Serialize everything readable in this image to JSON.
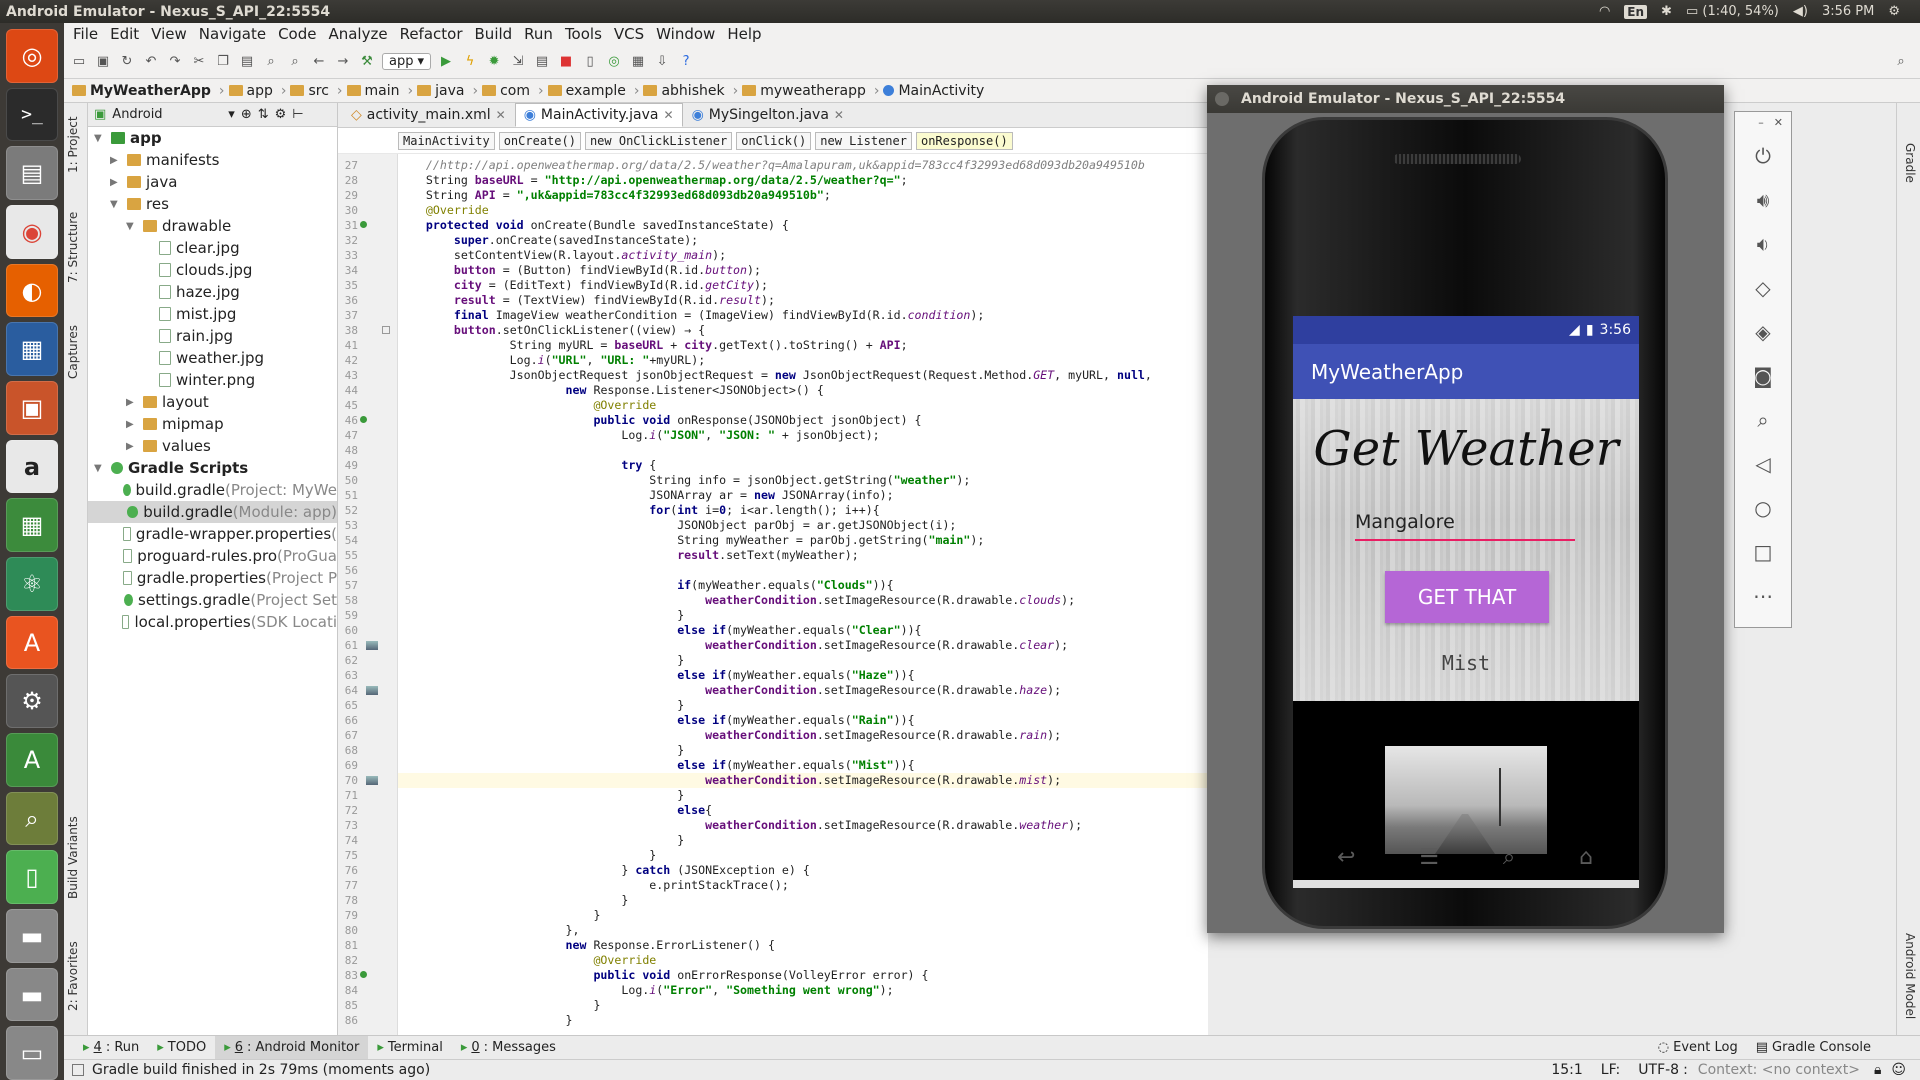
{
  "window_title": "Android Emulator - Nexus_S_API_22:5554",
  "tray": {
    "keyboard": "En",
    "battery": "(1:40, 54%)",
    "clock": "3:56 PM"
  },
  "menu": [
    "File",
    "Edit",
    "View",
    "Navigate",
    "Code",
    "Analyze",
    "Refactor",
    "Build",
    "Run",
    "Tools",
    "VCS",
    "Window",
    "Help"
  ],
  "run_config": "app",
  "breadcrumb": [
    "MyWeatherApp",
    "app",
    "src",
    "main",
    "java",
    "com",
    "example",
    "abhishek",
    "myweatherapp",
    "MainActivity"
  ],
  "project_view": "Android",
  "tree": [
    {
      "label": "app",
      "extra": "",
      "depth": 0,
      "kind": "module",
      "open": true
    },
    {
      "label": "manifests",
      "extra": "",
      "depth": 1,
      "kind": "folder",
      "open": false
    },
    {
      "label": "java",
      "extra": "",
      "depth": 1,
      "kind": "folder",
      "open": false
    },
    {
      "label": "res",
      "extra": "",
      "depth": 1,
      "kind": "folder",
      "open": true
    },
    {
      "label": "drawable",
      "extra": "",
      "depth": 2,
      "kind": "folder",
      "open": true
    },
    {
      "label": "clear.jpg",
      "extra": "",
      "depth": 3,
      "kind": "file"
    },
    {
      "label": "clouds.jpg",
      "extra": "",
      "depth": 3,
      "kind": "file"
    },
    {
      "label": "haze.jpg",
      "extra": "",
      "depth": 3,
      "kind": "file"
    },
    {
      "label": "mist.jpg",
      "extra": "",
      "depth": 3,
      "kind": "file"
    },
    {
      "label": "rain.jpg",
      "extra": "",
      "depth": 3,
      "kind": "file"
    },
    {
      "label": "weather.jpg",
      "extra": "",
      "depth": 3,
      "kind": "file"
    },
    {
      "label": "winter.png",
      "extra": "",
      "depth": 3,
      "kind": "file"
    },
    {
      "label": "layout",
      "extra": "",
      "depth": 2,
      "kind": "folder",
      "open": false
    },
    {
      "label": "mipmap",
      "extra": "",
      "depth": 2,
      "kind": "folder",
      "open": false
    },
    {
      "label": "values",
      "extra": "",
      "depth": 2,
      "kind": "folder",
      "open": false
    },
    {
      "label": "Gradle Scripts",
      "extra": "",
      "depth": 0,
      "kind": "gradle",
      "open": true
    },
    {
      "label": "build.gradle",
      "extra": " (Project: MyWe",
      "depth": 1,
      "kind": "gradle"
    },
    {
      "label": "build.gradle",
      "extra": " (Module: app)",
      "depth": 1,
      "kind": "gradle",
      "selected": true
    },
    {
      "label": "gradle-wrapper.properties",
      "extra": " (",
      "depth": 1,
      "kind": "file"
    },
    {
      "label": "proguard-rules.pro",
      "extra": " (ProGua",
      "depth": 1,
      "kind": "file"
    },
    {
      "label": "gradle.properties",
      "extra": " (Project P",
      "depth": 1,
      "kind": "file"
    },
    {
      "label": "settings.gradle",
      "extra": " (Project Set",
      "depth": 1,
      "kind": "gradle"
    },
    {
      "label": "local.properties",
      "extra": " (SDK Locati",
      "depth": 1,
      "kind": "file"
    }
  ],
  "editor_tabs": [
    {
      "label": "activity_main.xml",
      "active": false
    },
    {
      "label": "MainActivity.java",
      "active": true
    },
    {
      "label": "MySingelton.java",
      "active": false
    }
  ],
  "structure_bar": [
    "MainActivity",
    "onCreate()",
    "new OnClickListener",
    "onClick()",
    "new Listener",
    "onResponse()"
  ],
  "code_lines": [
    {
      "n": 27,
      "t": "    <span class=\"cm\">//http://api.openweathermap.org/data/2.5/weather?q=Amalapuram,uk&appid=783cc4f32993ed68d093db20a949510b</span>"
    },
    {
      "n": 28,
      "t": "    String <span class=\"fld\">baseURL</span> = <span class=\"st\">\"http://api.openweathermap.org/data/2.5/weather?q=\"</span>;"
    },
    {
      "n": 29,
      "t": "    String <span class=\"fld\">API</span> = <span class=\"st\">\",uk&appid=783cc4f32993ed68d093db20a949510b\"</span>;"
    },
    {
      "n": 30,
      "t": "    <span class=\"an\">@Override</span>"
    },
    {
      "n": 31,
      "t": "    <span class=\"kw\">protected void</span> onCreate(Bundle savedInstanceState) {"
    },
    {
      "n": 32,
      "t": "        <span class=\"kw\">super</span>.onCreate(savedInstanceState);"
    },
    {
      "n": 33,
      "t": "        setContentView(R.layout.<span class=\"sfi\">activity_main</span>);"
    },
    {
      "n": 34,
      "t": "        <span class=\"fld\">button</span> = (Button) findViewById(R.id.<span class=\"sfi\">button</span>);"
    },
    {
      "n": 35,
      "t": "        <span class=\"fld\">city</span> = (EditText) findViewById(R.id.<span class=\"sfi\">getCity</span>);"
    },
    {
      "n": 36,
      "t": "        <span class=\"fld\">result</span> = (TextView) findViewById(R.id.<span class=\"sfi\">result</span>);"
    },
    {
      "n": 37,
      "t": "        <span class=\"kw\">final</span> ImageView weatherCondition = (ImageView) findViewById(R.id.<span class=\"sfi\">condition</span>);"
    },
    {
      "n": 38,
      "t": "        <span class=\"fld\">button</span>.setOnClickListener((view) → {"
    },
    {
      "n": 41,
      "t": "                String myURL = <span class=\"fld\">baseURL</span> + <span class=\"fld\">city</span>.getText().toString() + <span class=\"fld\">API</span>;"
    },
    {
      "n": 42,
      "t": "                Log.<span class=\"sfi\">i</span>(<span class=\"st\">\"URL\"</span>, <span class=\"st\">\"URL: \"</span>+myURL);"
    },
    {
      "n": 43,
      "t": "                JsonObjectRequest jsonObjectRequest = <span class=\"kw\">new</span> JsonObjectRequest(Request.Method.<span class=\"sfi\">GET</span>, myURL, <span class=\"kw\">null</span>,"
    },
    {
      "n": 44,
      "t": "                        <span class=\"kw\">new</span> Response.Listener&lt;JSONObject&gt;() {"
    },
    {
      "n": 45,
      "t": "                            <span class=\"an\">@Override</span>"
    },
    {
      "n": 46,
      "t": "                            <span class=\"kw\">public void</span> onResponse(JSONObject jsonObject) {"
    },
    {
      "n": 47,
      "t": "                                Log.<span class=\"sfi\">i</span>(<span class=\"st\">\"JSON\"</span>, <span class=\"st\">\"JSON: \"</span> + jsonObject);"
    },
    {
      "n": 48,
      "t": ""
    },
    {
      "n": 49,
      "t": "                                <span class=\"kw\">try</span> {"
    },
    {
      "n": 50,
      "t": "                                    String info = jsonObject.getString(<span class=\"st\">\"weather\"</span>);"
    },
    {
      "n": 51,
      "t": "                                    JSONArray ar = <span class=\"kw\">new</span> JSONArray(info);"
    },
    {
      "n": 52,
      "t": "                                    <span class=\"kw\">for</span>(<span class=\"kw\">int</span> i=<span class=\"kw\">0</span>; i&lt;ar.length(); i++){"
    },
    {
      "n": 53,
      "t": "                                        JSONObject parObj = ar.getJSONObject(i);"
    },
    {
      "n": 54,
      "t": "                                        String myWeather = parObj.getString(<span class=\"st\">\"main\"</span>);"
    },
    {
      "n": 55,
      "t": "                                        <span class=\"fld\">result</span>.setText(myWeather);"
    },
    {
      "n": 56,
      "t": ""
    },
    {
      "n": 57,
      "t": "                                        <span class=\"kw\">if</span>(myWeather.equals(<span class=\"st\">\"Clouds\"</span>)){"
    },
    {
      "n": 58,
      "t": "                                            <span class=\"fld\">weatherCondition</span>.setImageResource(R.drawable.<span class=\"sfi\">clouds</span>);"
    },
    {
      "n": 59,
      "t": "                                        }"
    },
    {
      "n": 60,
      "t": "                                        <span class=\"kw\">else if</span>(myWeather.equals(<span class=\"st\">\"Clear\"</span>)){"
    },
    {
      "n": 61,
      "t": "                                            <span class=\"fld\">weatherCondition</span>.setImageResource(R.drawable.<span class=\"sfi\">clear</span>);"
    },
    {
      "n": 62,
      "t": "                                        }"
    },
    {
      "n": 63,
      "t": "                                        <span class=\"kw\">else if</span>(myWeather.equals(<span class=\"st\">\"Haze\"</span>)){"
    },
    {
      "n": 64,
      "t": "                                            <span class=\"fld\">weatherCondition</span>.setImageResource(R.drawable.<span class=\"sfi\">haze</span>);"
    },
    {
      "n": 65,
      "t": "                                        }"
    },
    {
      "n": 66,
      "t": "                                        <span class=\"kw\">else if</span>(myWeather.equals(<span class=\"st\">\"Rain\"</span>)){"
    },
    {
      "n": 67,
      "t": "                                            <span class=\"fld\">weatherCondition</span>.setImageResource(R.drawable.<span class=\"sfi\">rain</span>);"
    },
    {
      "n": 68,
      "t": "                                        }"
    },
    {
      "n": 69,
      "t": "                                        <span class=\"kw\">else if</span>(myWeather.equals(<span class=\"st\">\"Mist\"</span>)){"
    },
    {
      "n": 70,
      "t": "                                            <span class=\"fld\">weatherCondition</span>.setImageResource(R.drawable.<span class=\"sfi\">mist</span>);",
      "current": true
    },
    {
      "n": 71,
      "t": "                                        }"
    },
    {
      "n": 72,
      "t": "                                        <span class=\"kw\">else</span>{"
    },
    {
      "n": 73,
      "t": "                                            <span class=\"fld\">weatherCondition</span>.setImageResource(R.drawable.<span class=\"sfi\">weather</span>);"
    },
    {
      "n": 74,
      "t": "                                        }"
    },
    {
      "n": 75,
      "t": "                                    }"
    },
    {
      "n": 76,
      "t": "                                } <span class=\"kw\">catch</span> (JSONException e) {"
    },
    {
      "n": 77,
      "t": "                                    e.printStackTrace();"
    },
    {
      "n": 78,
      "t": "                                }"
    },
    {
      "n": 79,
      "t": "                            }"
    },
    {
      "n": 80,
      "t": "                        },"
    },
    {
      "n": 81,
      "t": "                        <span class=\"kw\">new</span> Response.ErrorListener() {"
    },
    {
      "n": 82,
      "t": "                            <span class=\"an\">@Override</span>"
    },
    {
      "n": 83,
      "t": "                            <span class=\"kw\">public void</span> onErrorResponse(VolleyError error) {"
    },
    {
      "n": 84,
      "t": "                                Log.<span class=\"sfi\">i</span>(<span class=\"st\">\"Error\"</span>, <span class=\"st\">\"Something went wrong\"</span>);"
    },
    {
      "n": 85,
      "t": "                            }"
    },
    {
      "n": 86,
      "t": "                        }"
    }
  ],
  "left_tool_tabs": [
    "1: Project",
    "7: Structure",
    "Captures",
    "Build Variants",
    "2: Favorites"
  ],
  "right_tool_tabs": [
    "Gradle",
    "Android Model"
  ],
  "emulator": {
    "title": "Android Emulator - Nexus_S_API_22:5554",
    "status_time": "3:56",
    "app_title": "MyWeatherApp",
    "heading": "Get Weather",
    "city_value": "Mangalore",
    "button_label": "GET THAT",
    "result_text": "Mist"
  },
  "bottom_tabs": [
    {
      "num": "4",
      "label": ": Run"
    },
    {
      "num": "",
      "label": "TODO"
    },
    {
      "num": "6",
      "label": ": Android Monitor",
      "active": true
    },
    {
      "num": "",
      "label": "Terminal"
    },
    {
      "num": "0",
      "label": ": Messages"
    }
  ],
  "bottom_right": [
    "Event Log",
    "Gradle Console"
  ],
  "status": {
    "message": "Gradle build finished in 2s 79ms (moments ago)",
    "position": "15:1",
    "lf": "LF:",
    "encoding": "UTF-8",
    "context": "Context: <no context>"
  },
  "colors": {
    "accent": "#3f51b5",
    "button": "#b566d6",
    "underline": "#e91e63"
  }
}
